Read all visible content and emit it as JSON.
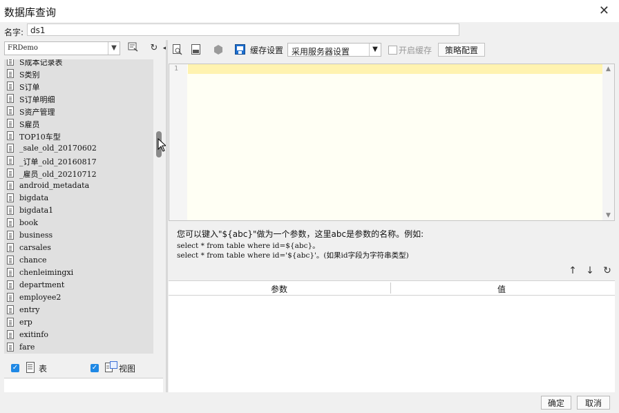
{
  "window": {
    "title": "数据库查询",
    "close_icon": "close-icon"
  },
  "name_row": {
    "label": "名字:",
    "value": "ds1"
  },
  "left": {
    "db_select": "FRDemo",
    "tree_items": [
      "S成本记录表",
      "S类别",
      "S订单",
      "S订单明细",
      "S资产管理",
      "S雇员",
      "TOP10车型",
      "_sale_old_20170602",
      "_订单_old_20160817",
      "_雇员_old_20210712",
      "android_metadata",
      "bigdata",
      "bigdata1",
      "book",
      "business",
      "carsales",
      "chance",
      "chenleimingxi",
      "department",
      "employee2",
      "entry",
      "erp",
      "exitinfo",
      "fare"
    ],
    "check_table": "表",
    "check_view": "视图"
  },
  "toolbar": {
    "cache_label": "缓存设置",
    "server_select": "采用服务器设置",
    "enable_cache": "开启缓存",
    "policy_button": "策略配置"
  },
  "editor": {
    "line1": "1"
  },
  "hint": {
    "line1": "您可以键入\"${abc}\"做为一个参数，这里abc是参数的名称。例如:",
    "line2": "select * from table where id=${abc}。",
    "line3": "select * from table where id='${abc}'。(如果id字段为字符串类型)"
  },
  "params": {
    "col_param": "参数",
    "col_value": "值"
  },
  "footer": {
    "ok": "确定",
    "cancel": "取消"
  }
}
